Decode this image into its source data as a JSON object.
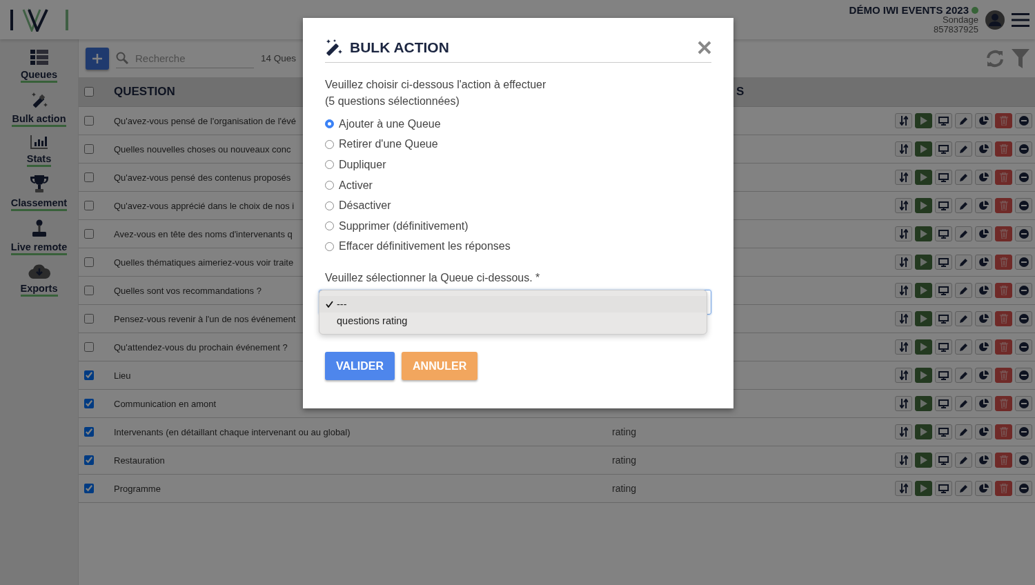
{
  "header": {
    "event_title": "DÉMO IWI EVENTS 2023",
    "subtitle": "Sondage",
    "code": "857837925"
  },
  "sidebar": {
    "items": [
      {
        "label": "Queues"
      },
      {
        "label": "Bulk action"
      },
      {
        "label": "Stats"
      },
      {
        "label": "Classement"
      },
      {
        "label": "Live remote"
      },
      {
        "label": "Exports"
      }
    ]
  },
  "toolbar": {
    "search": {
      "placeholder": "Recherche"
    },
    "count": "14 Ques"
  },
  "table": {
    "header_checked": false,
    "columns": [
      "QUESTION",
      "S"
    ],
    "rows": [
      {
        "checked": false,
        "question": "Qu'avez-vous pensé de l'organisation de l'évé"
      },
      {
        "checked": false,
        "question": "Quelles nouvelles choses ou nouveaux conc"
      },
      {
        "checked": false,
        "question": "Qu'avez-vous pensé des contenus proposés"
      },
      {
        "checked": false,
        "question": "Qu'avez-vous apprécié dans le choix de nos i"
      },
      {
        "checked": false,
        "question": "Avez-vous en tête des noms d'intervenants q"
      },
      {
        "checked": false,
        "question": "Quelles thématiques aimeriez-vous voir traite"
      },
      {
        "checked": false,
        "question": "Quelles sont vos recommandations ?"
      },
      {
        "checked": false,
        "question": "Pensez-vous revenir à l'un de nos événement"
      },
      {
        "checked": false,
        "question": "Qu'attendez-vous du prochain événement ?"
      },
      {
        "checked": true,
        "question": "Lieu"
      },
      {
        "checked": true,
        "question": "Communication en amont"
      },
      {
        "checked": true,
        "question": "Intervenants (en détaillant chaque intervenant ou au global)",
        "type": "rating"
      },
      {
        "checked": true,
        "question": "Restauration",
        "type": "rating"
      },
      {
        "checked": true,
        "question": "Programme",
        "type": "rating"
      }
    ]
  },
  "modal": {
    "title": "BULK ACTION",
    "intro": "Veuillez choisir ci-dessous l'action à effectuer\n(5 questions sélectionnées)",
    "options": [
      {
        "label": "Ajouter à une Queue",
        "selected": true
      },
      {
        "label": "Retirer d'une Queue",
        "selected": false
      },
      {
        "label": "Dupliquer",
        "selected": false
      },
      {
        "label": "Activer",
        "selected": false
      },
      {
        "label": "Désactiver",
        "selected": false
      },
      {
        "label": "Supprimer (définitivement)",
        "selected": false
      },
      {
        "label": "Effacer définitivement les réponses",
        "selected": false
      }
    ],
    "select_label": "Veuillez sélectionner la Queue ci-dessous. *",
    "dropdown": {
      "options": [
        {
          "label": "---",
          "selected": true
        },
        {
          "label": "questions rating",
          "selected": false
        }
      ]
    },
    "buttons": [
      {
        "label": "VALIDER",
        "kind": "primary"
      },
      {
        "label": "ANNULER",
        "kind": "secondary"
      }
    ]
  }
}
